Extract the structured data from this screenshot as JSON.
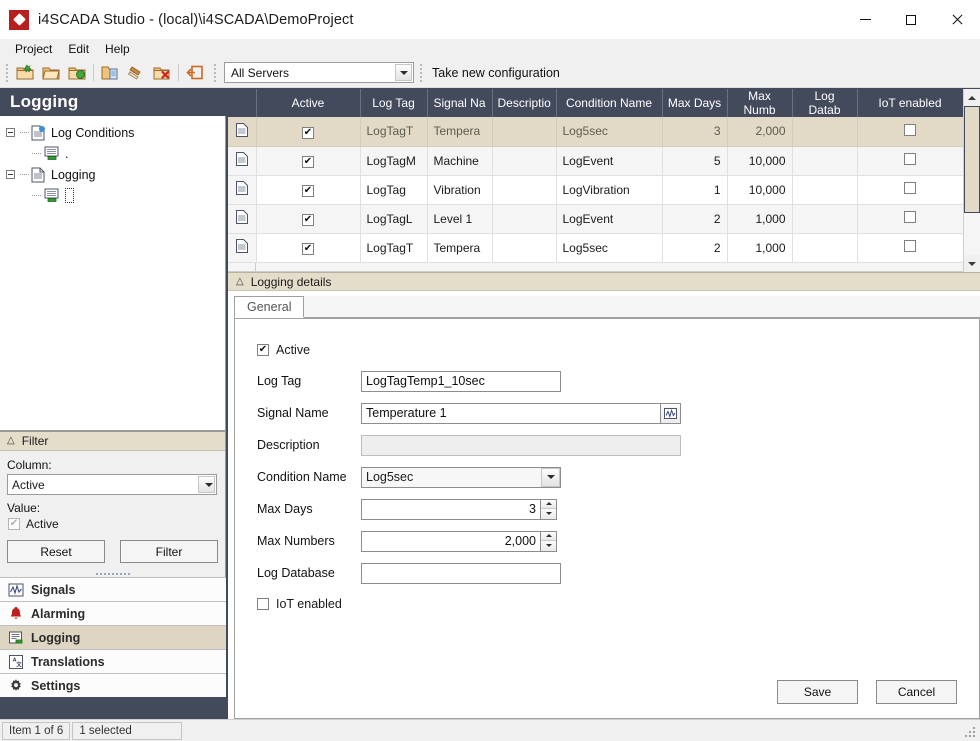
{
  "window": {
    "title": "i4SCADA Studio - (local)\\i4SCADA\\DemoProject",
    "app_icon": "i4scada-logo-icon",
    "controls": {
      "minimize": "minimize-icon",
      "maximize": "maximize-icon",
      "close": "close-icon"
    }
  },
  "menubar": {
    "items": [
      "Project",
      "Edit",
      "Help"
    ]
  },
  "toolbar": {
    "buttons": [
      {
        "name": "new-project-icon",
        "group": 1
      },
      {
        "name": "open-project-icon",
        "group": 1
      },
      {
        "name": "save-project-icon",
        "group": 1
      },
      {
        "name": "deploy-configuration-icon",
        "group": 2
      },
      {
        "name": "clean-configuration-icon",
        "group": 2
      },
      {
        "name": "delete-configuration-icon",
        "group": 2
      },
      {
        "name": "exit-icon",
        "group": 3
      }
    ],
    "server_select": {
      "value": "All Servers",
      "icon": "chevron-down-icon"
    },
    "take_new_configuration": "Take new configuration"
  },
  "left_panel": {
    "header": "Logging",
    "tree": [
      {
        "label": "Log Conditions",
        "icon": "log-conditions-doc-icon",
        "expander": "collapse-icon",
        "children": [
          {
            "label": ".",
            "icon": "server-icon"
          }
        ]
      },
      {
        "label": "Logging",
        "icon": "logging-doc-icon",
        "expander": "collapse-icon",
        "children": [
          {
            "label": "",
            "icon": "server-icon"
          }
        ]
      }
    ],
    "filter": {
      "header": "Filter",
      "header_icon": "chevron-up-icon",
      "column_label": "Column:",
      "column_value": "Active",
      "value_label": "Value:",
      "value_check_label": "Active",
      "reset_button": "Reset",
      "filter_button": "Filter"
    },
    "nav": [
      {
        "label": "Signals",
        "icon": "signals-icon",
        "active": false
      },
      {
        "label": "Alarming",
        "icon": "alarm-bell-icon",
        "active": false
      },
      {
        "label": "Logging",
        "icon": "logging-icon",
        "active": true
      },
      {
        "label": "Translations",
        "icon": "translations-icon",
        "active": false
      },
      {
        "label": "Settings",
        "icon": "gear-icon",
        "active": false
      }
    ]
  },
  "grid": {
    "columns": [
      "",
      "Active",
      "Log Tag",
      "Signal Na",
      "Descriptio",
      "Condition Name",
      "Max Days",
      "Max Numb",
      "Log Datab",
      "IoT enabled"
    ],
    "rows": [
      {
        "selected": true,
        "active": true,
        "log_tag": "LogTagT",
        "signal_name": "Tempera",
        "description": "",
        "condition_name": "Log5sec",
        "max_days": "3",
        "max_numbers": "2,000",
        "log_database": "",
        "iot_enabled": false
      },
      {
        "selected": false,
        "active": true,
        "log_tag": "LogTagM",
        "signal_name": "Machine",
        "description": "",
        "condition_name": "LogEvent",
        "max_days": "5",
        "max_numbers": "10,000",
        "log_database": "",
        "iot_enabled": false
      },
      {
        "selected": false,
        "active": true,
        "log_tag": "LogTag",
        "signal_name": "Vibration",
        "description": "",
        "condition_name": "LogVibration",
        "max_days": "1",
        "max_numbers": "10,000",
        "log_database": "",
        "iot_enabled": false
      },
      {
        "selected": false,
        "active": true,
        "log_tag": "LogTagL",
        "signal_name": "Level 1",
        "description": "",
        "condition_name": "LogEvent",
        "max_days": "2",
        "max_numbers": "1,000",
        "log_database": "",
        "iot_enabled": false
      },
      {
        "selected": false,
        "active": true,
        "log_tag": "LogTagT",
        "signal_name": "Tempera",
        "description": "",
        "condition_name": "Log5sec",
        "max_days": "2",
        "max_numbers": "1,000",
        "log_database": "",
        "iot_enabled": false
      }
    ],
    "scrollbar": {
      "up_icon": "scroll-up-icon",
      "down_icon": "scroll-down-icon"
    }
  },
  "details": {
    "header": "Logging details",
    "header_icon": "chevron-up-icon",
    "tabs": [
      {
        "label": "General",
        "active": true
      }
    ],
    "form": {
      "active_label": "Active",
      "active_checked": true,
      "log_tag_label": "Log Tag",
      "log_tag_value": "LogTagTemp1_10sec",
      "signal_name_label": "Signal Name",
      "signal_name_value": "Temperature 1",
      "signal_picker_icon": "signal-picker-icon",
      "description_label": "Description",
      "description_value": "",
      "condition_name_label": "Condition Name",
      "condition_name_value": "Log5sec",
      "condition_dropdown_icon": "chevron-down-icon",
      "max_days_label": "Max Days",
      "max_days_value": "3",
      "max_numbers_label": "Max Numbers",
      "max_numbers_value": "2,000",
      "log_database_label": "Log Database",
      "log_database_value": "",
      "iot_label": "IoT enabled",
      "iot_checked": false,
      "save_button": "Save",
      "cancel_button": "Cancel"
    }
  },
  "statusbar": {
    "item_count": "Item 1 of 6",
    "selection": "1 selected"
  },
  "colors": {
    "chrome_dark": "#434a5c",
    "selection_tan": "#e2dac6",
    "panel_header_tan": "#e4ddca",
    "toolbar_bg": "#f0f0f0",
    "accent_red": "#b71f1f"
  }
}
